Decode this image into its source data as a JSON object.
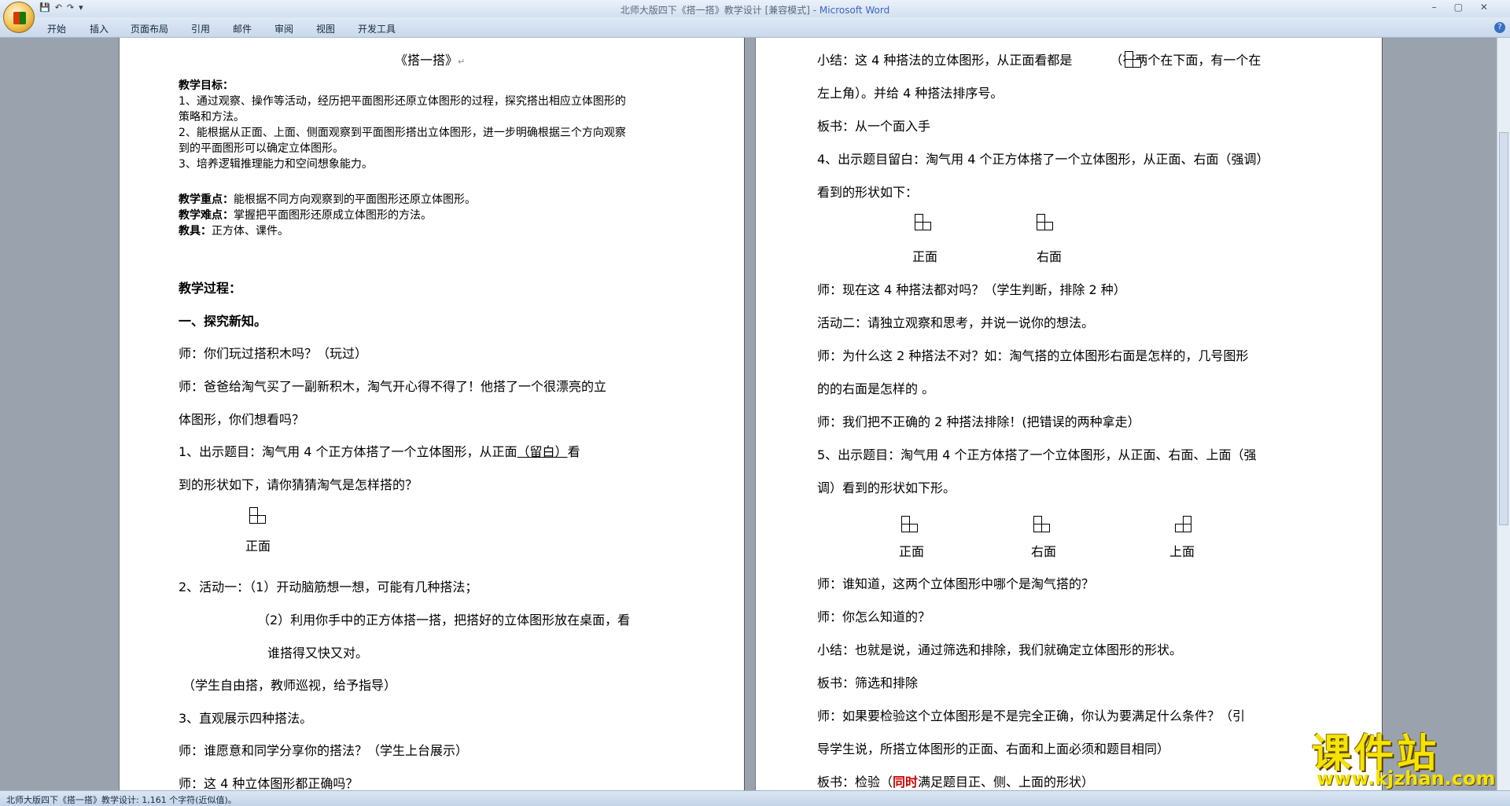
{
  "window": {
    "title": "北师大版四下《搭一搭》教学设计 [兼容模式] - ",
    "app": "Microsoft Word"
  },
  "ribbon": {
    "tabs": [
      "开始",
      "插入",
      "页面布局",
      "引用",
      "邮件",
      "审阅",
      "视图",
      "开发工具"
    ]
  },
  "status": {
    "text": "北师大版四下《搭一搭》教学设计: 1,161 个字符(近似值)。"
  },
  "watermark": {
    "main": "课件站",
    "url": "www.kjzhan.com"
  },
  "page1": {
    "title": "《搭一搭》",
    "goal_head": "教学目标：",
    "goal1a": "1、通过观察、操作等活动，经历把平面图形还原立体图形的过程，探究搭出相应立体图形的",
    "goal1b": "策略和方法。",
    "goal2a": "2、能根据从正面、上面、侧面观察到平面图形搭出立体图形，进一步明确根据三个方向观察",
    "goal2b": "到的平面图形可以确定立体图形。",
    "goal3": "3、培养逻辑推理能力和空间想象能力。",
    "key_head": "教学重点：",
    "key_text": "能根据不同方向观察到的平面图形还原立体图形。",
    "diff_head": "教学难点：",
    "diff_text": "掌握把平面图形还原成立体图形的方法。",
    "tool_head": "教具：",
    "tool_text": "正方体、课件。",
    "process": "教学过程：",
    "sec1": "一、探究新知。",
    "p1": "师：你们玩过搭积木吗？（玩过）",
    "p2a": "师：爸爸给淘气买了一副新积木，淘气开心得不得了！他搭了一个很漂亮的立",
    "p2b": "体图形，你们想看吗？",
    "p3a": "1、出示题目：淘气用 4 个正方体搭了一个立体图形，从正面",
    "p3u": "（留白）",
    "p3c": "看",
    "p3d": "到的形状如下，请你猜猜淘气是怎样搭的？",
    "lbl_front": "正面",
    "p4": "2、活动一：（1）开动脑筋想一想，可能有几种搭法；",
    "p5a": "（2）利用你手中的正方体搭一搭，把搭好的立体图形放在桌面，看",
    "p5b": "谁搭得又快又对。",
    "p6": "（学生自由搭，教师巡视，给予指导）",
    "p7": "3、直观展示四种搭法。",
    "p8": "师：谁愿意和同学分享你的搭法？（学生上台展示）",
    "p9": "师：这 4 种立体图形都正确吗？"
  },
  "page2": {
    "l1a": "小结：这 4 种搭法的立体图形，从正面看都是",
    "l1b": "（有两个在下面，有一个在",
    "l2": "左上角）。并给 4 种搭法排序号。",
    "l3": "板书：从一个面入手",
    "l4": "4、出示题目留白：淘气用 4 个正方体搭了一个立体图形，从正面、右面（强调）",
    "l5": "看到的形状如下：",
    "lbl_front": "正面",
    "lbl_right": "右面",
    "lbl_top": "上面",
    "l6": "师：现在这 4 种搭法都对吗？（学生判断，排除 2 种）",
    "l7": "活动二：请独立观察和思考，并说一说你的想法。",
    "l8": "师：为什么这 2 种搭法不对？如：淘气搭的立体图形右面是怎样的，几号图形",
    "l9": "的的右面是怎样的 。",
    "l10": "师：我们把不正确的 2 种搭法排除！(把错误的两种拿走）",
    "l11": "5、出示题目：淘气用 4 个正方体搭了一个立体图形，从正面、右面、上面（强",
    "l12": "调）看到的形状如下形。",
    "l13": "师：谁知道，这两个立体图形中哪个是淘气搭的？",
    "l14": "师：你怎么知道的？",
    "l15": "小结：也就是说，通过筛选和排除，我们就确定立体图形的形状。",
    "l16": "板书：筛选和排除",
    "l17": "师：如果要检验这个立体图形是不是完全正确，你认为要满足什么条件？（引",
    "l18": "导学生说，所搭立体图形的正面、右面和上面必须和题目相同）",
    "l19a": "板书：检验（",
    "l19b": "同时",
    "l19c": "满足题目正、侧、上面的形状）"
  }
}
